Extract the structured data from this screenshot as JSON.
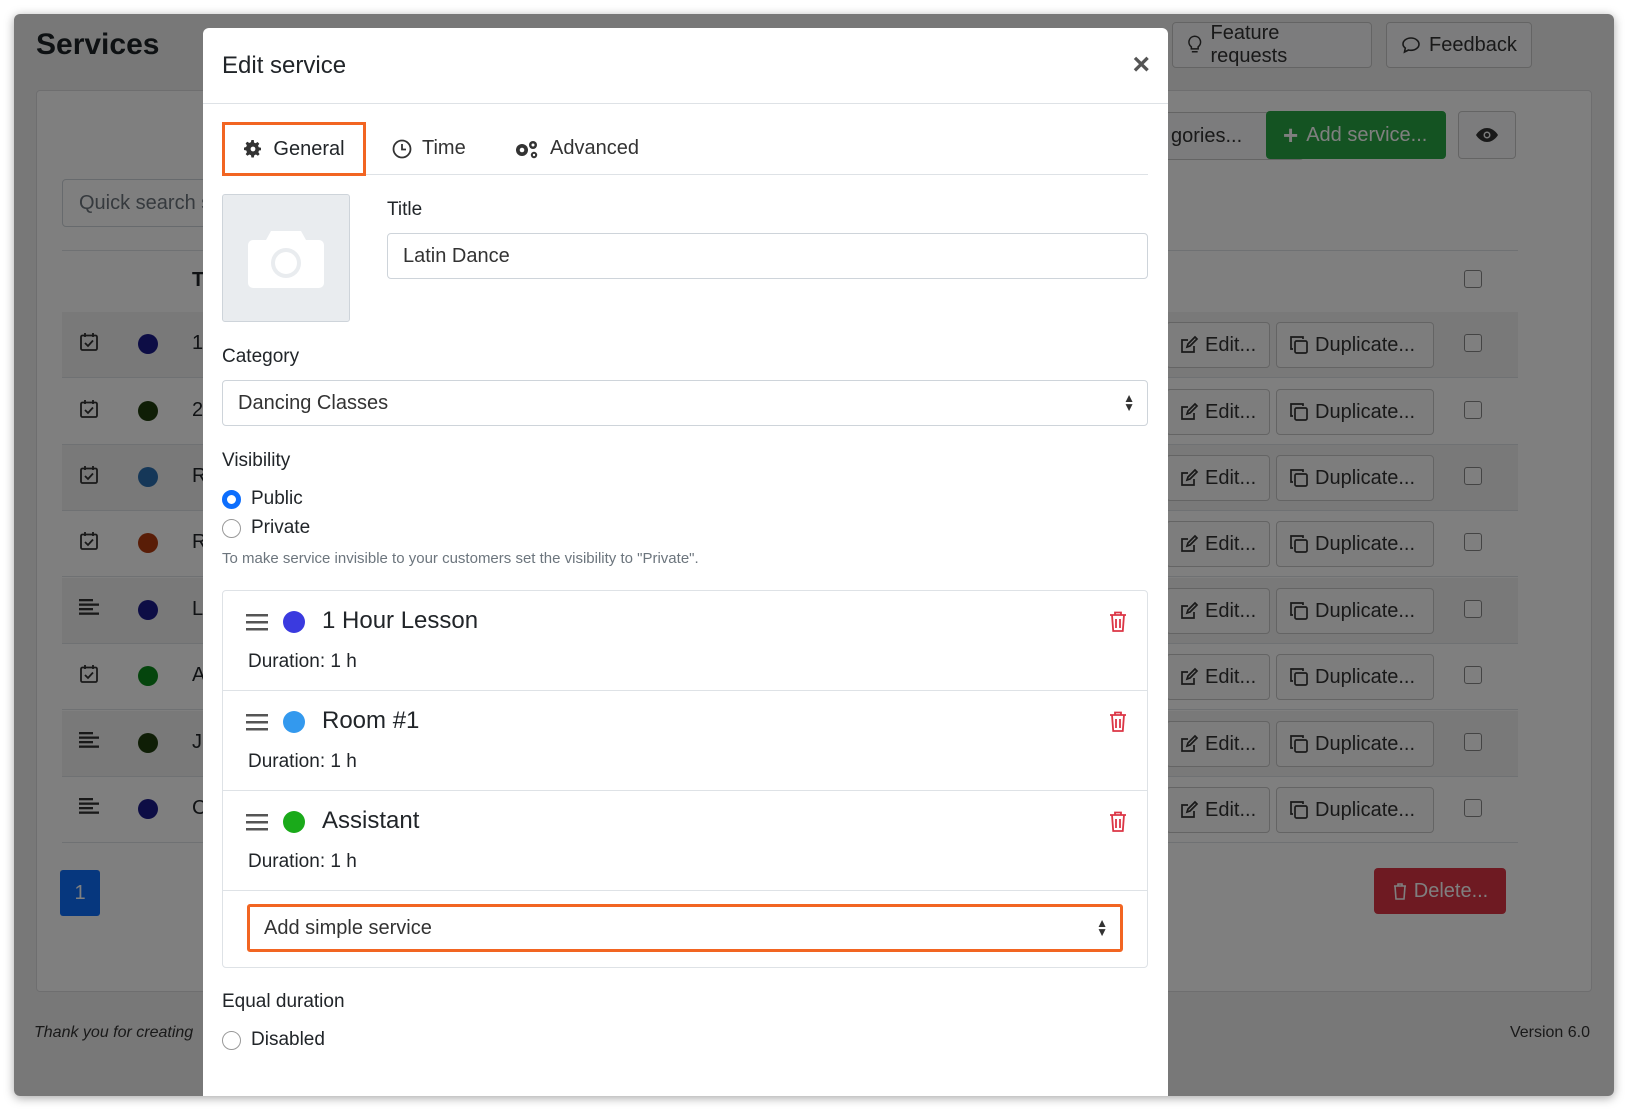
{
  "background": {
    "page_title": "Services",
    "top_buttons": {
      "feature_requests": "Feature requests",
      "feedback": "Feedback"
    },
    "search_placeholder": "Quick search s",
    "categories_button": "gories...",
    "add_service_button": "Add service...",
    "table_header_col": "T",
    "rows": [
      {
        "icon": "calendar-check-icon",
        "color": "#1a1a8a",
        "text": "1",
        "edit": "Edit...",
        "duplicate": "Duplicate..."
      },
      {
        "icon": "calendar-check-icon",
        "color": "#1f3d0c",
        "text": "2",
        "edit": "Edit...",
        "duplicate": "Duplicate..."
      },
      {
        "icon": "calendar-check-icon",
        "color": "#2a6fb0",
        "text": "R",
        "edit": "Edit...",
        "duplicate": "Duplicate..."
      },
      {
        "icon": "calendar-check-icon",
        "color": "#b33a0f",
        "text": "R",
        "edit": "Edit...",
        "duplicate": "Duplicate..."
      },
      {
        "icon": "align-left-icon",
        "color": "#1a1a8a",
        "text": "L",
        "edit": "Edit...",
        "duplicate": "Duplicate..."
      },
      {
        "icon": "calendar-check-icon",
        "color": "#0a8a1a",
        "text": "A",
        "edit": "Edit...",
        "duplicate": "Duplicate..."
      },
      {
        "icon": "align-left-icon",
        "color": "#1f3d0c",
        "text": "J",
        "edit": "Edit...",
        "duplicate": "Duplicate..."
      },
      {
        "icon": "align-left-icon",
        "color": "#1a1a8a",
        "text": "C",
        "edit": "Edit...",
        "duplicate": "Duplicate..."
      }
    ],
    "pagination_current": "1",
    "delete_button": "Delete...",
    "footer_left": "Thank you for creating",
    "footer_right": "Version 6.0"
  },
  "modal": {
    "title": "Edit service",
    "close_symbol": "×",
    "tabs": [
      {
        "label": "General",
        "icon": "gear-icon",
        "active": true
      },
      {
        "label": "Time",
        "icon": "clock-icon",
        "active": false
      },
      {
        "label": "Advanced",
        "icon": "gears-icon",
        "active": false
      }
    ],
    "title_label": "Title",
    "title_value": "Latin Dance",
    "category_label": "Category",
    "category_value": "Dancing Classes",
    "visibility_label": "Visibility",
    "visibility_options": [
      {
        "label": "Public",
        "checked": true
      },
      {
        "label": "Private",
        "checked": false
      }
    ],
    "visibility_hint": "To make service invisible to your customers set the visibility to \"Private\".",
    "simple_services": [
      {
        "name": "1 Hour Lesson",
        "color": "#3a3adf",
        "duration": "Duration: 1 h"
      },
      {
        "name": "Room #1",
        "color": "#3399ee",
        "duration": "Duration: 1 h"
      },
      {
        "name": "Assistant",
        "color": "#1aaa1a",
        "duration": "Duration: 1 h"
      }
    ],
    "add_simple_service": "Add simple service",
    "equal_duration_label": "Equal duration",
    "equal_duration_option": "Disabled"
  },
  "colors": {
    "accent_highlight": "#f26522",
    "primary": "#0d6efd",
    "danger": "#dc3545",
    "success": "#28a745"
  }
}
